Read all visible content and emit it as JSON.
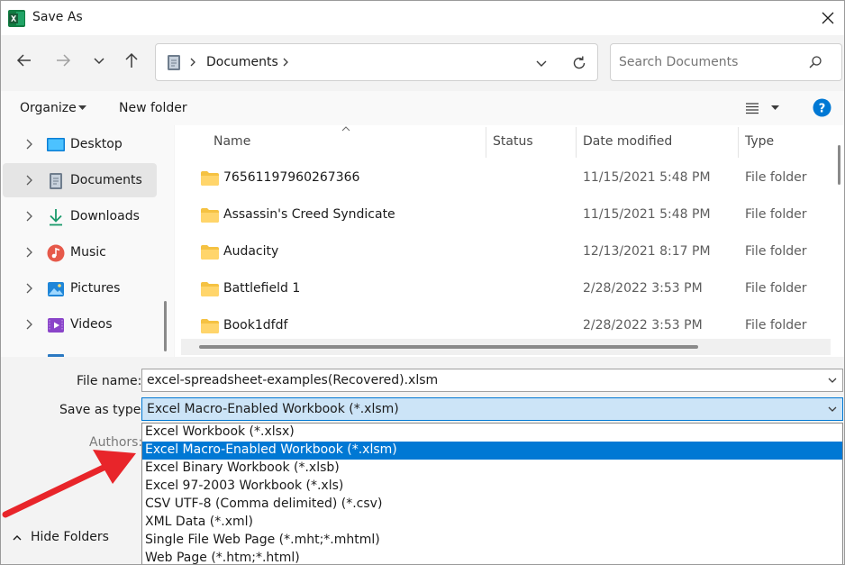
{
  "window": {
    "title": "Save As",
    "app_icon": "excel-icon"
  },
  "nav": {
    "back_icon": "back-arrow-icon",
    "forward_icon": "forward-arrow-icon",
    "recent_icon": "chevron-down-icon",
    "up_icon": "up-arrow-icon",
    "address": {
      "crumbs": [
        "Documents"
      ],
      "folder_icon": "documents-icon"
    },
    "refresh_icon": "refresh-icon",
    "search": {
      "placeholder": "Search Documents",
      "icon": "search-icon"
    }
  },
  "commandbar": {
    "organize_label": "Organize",
    "new_folder_label": "New folder",
    "view_icon": "list-view-icon",
    "help_icon": "help-icon"
  },
  "sidebar": {
    "items": [
      {
        "label": "Desktop",
        "icon": "desktop-icon"
      },
      {
        "label": "Documents",
        "icon": "documents-icon",
        "selected": true
      },
      {
        "label": "Downloads",
        "icon": "downloads-icon"
      },
      {
        "label": "Music",
        "icon": "music-icon"
      },
      {
        "label": "Pictures",
        "icon": "pictures-icon"
      },
      {
        "label": "Videos",
        "icon": "videos-icon"
      }
    ]
  },
  "files": {
    "columns": [
      "Name",
      "Status",
      "Date modified",
      "Type"
    ],
    "rows": [
      {
        "name": "76561197960267366",
        "date": "11/15/2021 5:48 PM",
        "type": "File folder"
      },
      {
        "name": "Assassin's Creed Syndicate",
        "date": "11/15/2021 5:48 PM",
        "type": "File folder"
      },
      {
        "name": "Audacity",
        "date": "12/13/2021 8:17 PM",
        "type": "File folder"
      },
      {
        "name": "Battlefield 1",
        "date": "2/28/2022 3:53 PM",
        "type": "File folder"
      },
      {
        "name": "Book1dfdf",
        "date": "2/28/2022 3:53 PM",
        "type": "File folder"
      }
    ]
  },
  "form": {
    "filename_label": "File name:",
    "filename_value": "excel-spreadsheet-examples(Recovered).xlsm",
    "savetype_label": "Save as type:",
    "savetype_value": "Excel Macro-Enabled Workbook (*.xlsm)",
    "authors_label": "Authors:",
    "hide_folders_label": "Hide Folders"
  },
  "savetype_options": [
    "Excel Workbook (*.xlsx)",
    "Excel Macro-Enabled Workbook (*.xlsm)",
    "Excel Binary Workbook (*.xlsb)",
    "Excel 97-2003 Workbook (*.xls)",
    "CSV UTF-8 (Comma delimited) (*.csv)",
    "XML Data (*.xml)",
    "Single File Web Page (*.mht;*.mhtml)",
    "Web Page (*.htm;*.html)"
  ],
  "colors": {
    "accent": "#0078d4",
    "arrow": "#e8252a",
    "folder": "#f5c242"
  }
}
